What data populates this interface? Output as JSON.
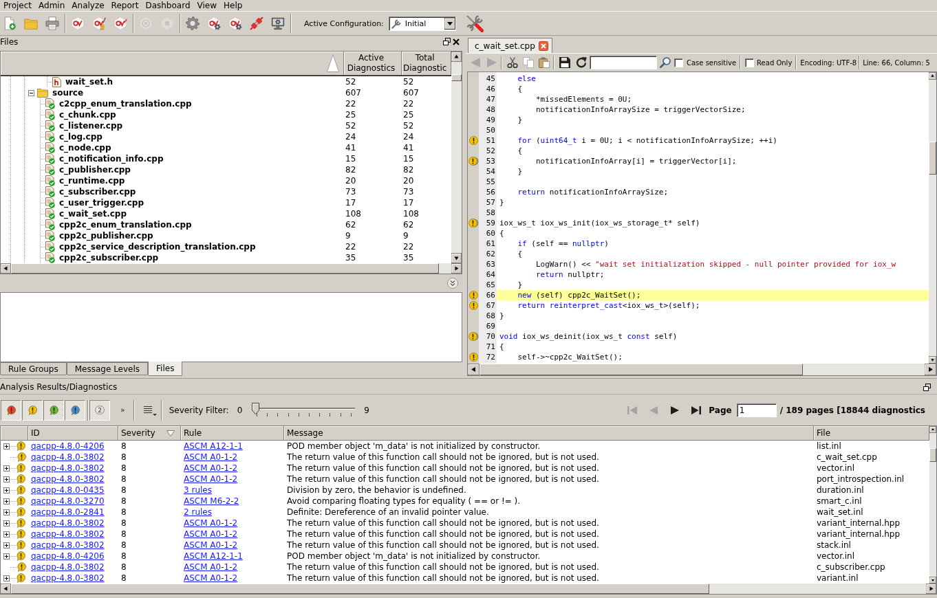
{
  "menu": [
    "Project",
    "Admin",
    "Analyze",
    "Report",
    "Dashboard",
    "View",
    "Help"
  ],
  "toolbar": {
    "groups": [
      [
        {
          "kind": "new_file",
          "disabled": false
        },
        {
          "kind": "open",
          "disabled": false
        },
        {
          "kind": "print",
          "disabled": false
        }
      ],
      [
        {
          "kind": "analyze",
          "disabled": false
        },
        {
          "kind": "clean",
          "disabled": false
        },
        {
          "kind": "reanalyze",
          "disabled": false
        }
      ],
      [
        {
          "kind": "cancel",
          "disabled": true
        },
        {
          "kind": "stop",
          "disabled": true
        }
      ],
      [
        {
          "kind": "settings",
          "disabled": false
        },
        {
          "kind": "analyze_settings",
          "disabled": false
        },
        {
          "kind": "reanalyze_settings",
          "disabled": false
        },
        {
          "kind": "connect",
          "disabled": false
        },
        {
          "kind": "monitor",
          "disabled": false
        }
      ]
    ],
    "config_label": "Active Configuration:",
    "config_value": "Initial"
  },
  "files_panel": {
    "title": "Files",
    "columns": [
      "Active Diagnostics",
      "Total Diagnostic"
    ],
    "tree": [
      {
        "name": "wait_set.h",
        "kind": "header",
        "active": "52",
        "total": "52"
      },
      {
        "name": "source",
        "kind": "folder",
        "expanded": true,
        "active": "607",
        "total": "607",
        "children": [
          {
            "name": "c2cpp_enum_translation.cpp",
            "kind": "source",
            "active": "22",
            "total": "22"
          },
          {
            "name": "c_chunk.cpp",
            "kind": "source",
            "active": "25",
            "total": "25"
          },
          {
            "name": "c_listener.cpp",
            "kind": "source",
            "active": "52",
            "total": "52"
          },
          {
            "name": "c_log.cpp",
            "kind": "source",
            "active": "24",
            "total": "24"
          },
          {
            "name": "c_node.cpp",
            "kind": "source",
            "active": "41",
            "total": "41"
          },
          {
            "name": "c_notification_info.cpp",
            "kind": "source",
            "active": "15",
            "total": "15"
          },
          {
            "name": "c_publisher.cpp",
            "kind": "source",
            "active": "82",
            "total": "82"
          },
          {
            "name": "c_runtime.cpp",
            "kind": "source",
            "active": "20",
            "total": "20"
          },
          {
            "name": "c_subscriber.cpp",
            "kind": "source",
            "active": "73",
            "total": "73"
          },
          {
            "name": "c_user_trigger.cpp",
            "kind": "source",
            "active": "17",
            "total": "17"
          },
          {
            "name": "c_wait_set.cpp",
            "kind": "source",
            "active": "108",
            "total": "108"
          },
          {
            "name": "cpp2c_enum_translation.cpp",
            "kind": "source",
            "active": "62",
            "total": "62"
          },
          {
            "name": "cpp2c_publisher.cpp",
            "kind": "source",
            "active": "9",
            "total": "9"
          },
          {
            "name": "cpp2c_service_description_translation.cpp",
            "kind": "source",
            "active": "22",
            "total": "22"
          },
          {
            "name": "cpp2c_subscriber.cpp",
            "kind": "source",
            "active": "35",
            "total": "35"
          }
        ]
      }
    ],
    "tabs": [
      {
        "label": "Rule Groups",
        "selected": false
      },
      {
        "label": "Message Levels",
        "selected": false
      },
      {
        "label": "Files",
        "selected": true
      }
    ]
  },
  "editor": {
    "tab": "c_wait_set.cpp",
    "history": [
      {
        "kind": "back",
        "disabled": true
      },
      {
        "kind": "forward",
        "disabled": true
      }
    ],
    "case_sensitive": {
      "label": "Case sensitive",
      "checked": false
    },
    "read_only": {
      "label": "Read Only",
      "checked": false
    },
    "encoding": "Encoding: UTF-8",
    "position": "Line: 66, Column: 5",
    "lines": [
      {
        "number": "45",
        "highlighted": false,
        "tokens": [
          {
            "kind": "keyword",
            "text": "    else"
          }
        ]
      },
      {
        "number": "46",
        "highlighted": false,
        "tokens": [
          {
            "kind": "plain",
            "text": "    {"
          }
        ]
      },
      {
        "number": "47",
        "highlighted": false,
        "tokens": [
          {
            "kind": "plain",
            "text": "        *missedElements = 0U;"
          }
        ]
      },
      {
        "number": "48",
        "highlighted": false,
        "tokens": [
          {
            "kind": "plain",
            "text": "        notificationInfoArraySize = triggerVectorSize;"
          }
        ]
      },
      {
        "number": "49",
        "highlighted": false,
        "tokens": [
          {
            "kind": "plain",
            "text": "    }"
          }
        ]
      },
      {
        "number": "50",
        "highlighted": false
      },
      {
        "number": "51",
        "highlighted": false,
        "marker": {
          "kind": "warning"
        },
        "tokens": [
          {
            "kind": "keyword",
            "text": "    for"
          },
          {
            "kind": "plain",
            "text": " ("
          },
          {
            "kind": "keyword",
            "text": "uint64_t"
          },
          {
            "kind": "plain",
            "text": " i = 0U; i < notificationInfoArraySize; ++i)"
          }
        ]
      },
      {
        "number": "52",
        "highlighted": false,
        "tokens": [
          {
            "kind": "plain",
            "text": "    {"
          }
        ]
      },
      {
        "number": "53",
        "highlighted": false,
        "marker": {
          "kind": "warning_stack"
        },
        "tokens": [
          {
            "kind": "plain",
            "text": "        notificationInfoArray[i] = triggerVector[i];"
          }
        ]
      },
      {
        "number": "54",
        "highlighted": false,
        "tokens": [
          {
            "kind": "plain",
            "text": "    }"
          }
        ]
      },
      {
        "number": "55",
        "highlighted": false
      },
      {
        "number": "56",
        "highlighted": false,
        "tokens": [
          {
            "kind": "keyword",
            "text": "    return"
          },
          {
            "kind": "plain",
            "text": " notificationInfoArraySize;"
          }
        ]
      },
      {
        "number": "57",
        "highlighted": false,
        "tokens": [
          {
            "kind": "plain",
            "text": "}"
          }
        ]
      },
      {
        "number": "58",
        "highlighted": false
      },
      {
        "number": "59",
        "highlighted": false,
        "marker": {
          "kind": "warning_stack"
        },
        "tokens": [
          {
            "kind": "plain",
            "text": "iox_ws_t iox_ws_init(iox_ws_storage_t* self)"
          }
        ]
      },
      {
        "number": "60",
        "highlighted": false,
        "tokens": [
          {
            "kind": "plain",
            "text": "{"
          }
        ]
      },
      {
        "number": "61",
        "highlighted": false,
        "tokens": [
          {
            "kind": "keyword",
            "text": "    if"
          },
          {
            "kind": "plain",
            "text": " (self == "
          },
          {
            "kind": "keyword",
            "text": "nullptr"
          },
          {
            "kind": "plain",
            "text": ")"
          }
        ]
      },
      {
        "number": "62",
        "highlighted": false,
        "tokens": [
          {
            "kind": "plain",
            "text": "    {"
          }
        ]
      },
      {
        "number": "63",
        "highlighted": false,
        "tokens": [
          {
            "kind": "plain",
            "text": "        LogWarn() << "
          },
          {
            "kind": "string",
            "text": "\"wait set initialization skipped - null pointer provided for iox_w"
          }
        ]
      },
      {
        "number": "64",
        "highlighted": false,
        "tokens": [
          {
            "kind": "keyword",
            "text": "        return"
          },
          {
            "kind": "plain",
            "text": " nullptr;"
          }
        ]
      },
      {
        "number": "65",
        "highlighted": false,
        "tokens": [
          {
            "kind": "plain",
            "text": "    }"
          }
        ]
      },
      {
        "number": "66",
        "highlighted": true,
        "marker": {
          "kind": "warning"
        },
        "tokens": [
          {
            "kind": "keyword",
            "text": "    new"
          },
          {
            "kind": "plain",
            "text": " (self) cpp2c_WaitSet();"
          }
        ]
      },
      {
        "number": "67",
        "highlighted": false,
        "marker": {
          "kind": "warning"
        },
        "tokens": [
          {
            "kind": "keyword",
            "text": "    return reinterpret_cast"
          },
          {
            "kind": "plain",
            "text": "<iox_ws_t>(self);"
          }
        ]
      },
      {
        "number": "68",
        "highlighted": false,
        "tokens": [
          {
            "kind": "plain",
            "text": "}"
          }
        ]
      },
      {
        "number": "69",
        "highlighted": false
      },
      {
        "number": "70",
        "highlighted": false,
        "marker": {
          "kind": "warning_stack"
        },
        "tokens": [
          {
            "kind": "keyword",
            "text": "void"
          },
          {
            "kind": "plain",
            "text": " iox_ws_deinit(iox_ws_t "
          },
          {
            "kind": "keyword",
            "text": "const"
          },
          {
            "kind": "plain",
            "text": " self)"
          }
        ]
      },
      {
        "number": "71",
        "highlighted": false,
        "tokens": [
          {
            "kind": "plain",
            "text": "{"
          }
        ]
      },
      {
        "number": "72",
        "highlighted": false,
        "marker": {
          "kind": "warning"
        },
        "tokens": [
          {
            "kind": "plain",
            "text": "    self->~cpp2c_WaitSet();"
          }
        ]
      }
    ]
  },
  "results": {
    "title": "Analysis Results/Diagnostics",
    "severity_toggles": [
      {
        "color": "#e8412c",
        "checked": true
      },
      {
        "color": "#f2c200",
        "checked": true
      },
      {
        "color": "#62b838",
        "checked": true
      },
      {
        "color": "#3a8fd6",
        "checked": true
      }
    ],
    "level_toggle": {
      "label": "2",
      "checked": true
    },
    "more": "»",
    "filter_label": "Severity Filter:",
    "filter_min": "0",
    "filter_max": "9",
    "filter": {
      "level": 0
    },
    "nav": [
      {
        "kind": "first",
        "disabled": true
      },
      {
        "kind": "previous",
        "disabled": true
      },
      {
        "kind": "next",
        "disabled": false
      },
      {
        "kind": "last",
        "disabled": false
      }
    ],
    "page_label": "Page",
    "page_value": "1",
    "page_summary": "/ 189 pages [18844 diagnostics",
    "columns": [
      "ID",
      "Severity",
      "Rule",
      "Message",
      "File"
    ],
    "rows": [
      {
        "expandable": true,
        "id": "qacpp-4.8.0-4206",
        "severity": "8",
        "rule": "ASCM A12-1-1",
        "message": "POD member object 'm_data' is not initialized by constructor.",
        "file": "list.inl"
      },
      {
        "expandable": false,
        "id": "qacpp-4.8.0-3802",
        "severity": "8",
        "rule": "ASCM A0-1-2",
        "message": "The return value of this function call should not be ignored, but is not used.",
        "file": "c_wait_set.cpp"
      },
      {
        "expandable": true,
        "id": "qacpp-4.8.0-3802",
        "severity": "8",
        "rule": "ASCM A0-1-2",
        "message": "The return value of this function call should not be ignored, but is not used.",
        "file": "vector.inl"
      },
      {
        "expandable": true,
        "id": "qacpp-4.8.0-3802",
        "severity": "8",
        "rule": "ASCM A0-1-2",
        "message": "The return value of this function call should not be ignored, but is not used.",
        "file": "port_introspection.inl"
      },
      {
        "expandable": true,
        "id": "qacpp-4.8.0-0435",
        "severity": "8",
        "rule": "3 rules",
        "message": "Division by zero, the behavior is undefined.",
        "file": "duration.inl"
      },
      {
        "expandable": true,
        "id": "qacpp-4.8.0-3270",
        "severity": "8",
        "rule": "ASCM M6-2-2",
        "message": "Avoid comparing floating types for equality ( == or != ).",
        "file": "smart_c.inl"
      },
      {
        "expandable": true,
        "id": "qacpp-4.8.0-2841",
        "severity": "8",
        "rule": "2 rules",
        "message": "Definite: Dereference of an invalid pointer value.",
        "file": "wait_set.inl"
      },
      {
        "expandable": true,
        "id": "qacpp-4.8.0-3802",
        "severity": "8",
        "rule": "ASCM A0-1-2",
        "message": "The return value of this function call should not be ignored, but is not used.",
        "file": "variant_internal.hpp"
      },
      {
        "expandable": true,
        "id": "qacpp-4.8.0-3802",
        "severity": "8",
        "rule": "ASCM A0-1-2",
        "message": "The return value of this function call should not be ignored, but is not used.",
        "file": "variant_internal.hpp"
      },
      {
        "expandable": true,
        "id": "qacpp-4.8.0-3802",
        "severity": "8",
        "rule": "ASCM A0-1-2",
        "message": "The return value of this function call should not be ignored, but is not used.",
        "file": "stack.inl"
      },
      {
        "expandable": true,
        "id": "qacpp-4.8.0-4206",
        "severity": "8",
        "rule": "ASCM A12-1-1",
        "message": "POD member object 'm_data' is not initialized by constructor.",
        "file": "vector.inl"
      },
      {
        "expandable": false,
        "id": "qacpp-4.8.0-3802",
        "severity": "8",
        "rule": "ASCM A0-1-2",
        "message": "The return value of this function call should not be ignored, but is not used.",
        "file": "c_subscriber.cpp"
      },
      {
        "expandable": true,
        "id": "qacpp-4.8.0-3802",
        "severity": "8",
        "rule": "ASCM A0-1-2",
        "message": "The return value of this function call should not be ignored, but is not used.",
        "file": "variant.inl"
      }
    ]
  }
}
